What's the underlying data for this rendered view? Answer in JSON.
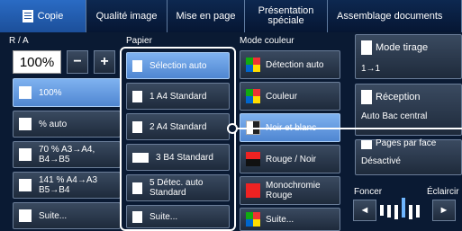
{
  "tabs": [
    {
      "label": "Copie",
      "active": true
    },
    {
      "label": "Qualité image"
    },
    {
      "label": "Mise en page"
    },
    {
      "label": "Présentation spéciale"
    },
    {
      "label": "Assemblage documents"
    }
  ],
  "ratio": {
    "header": "R / A",
    "value": "100%",
    "minus": "−",
    "plus": "+",
    "options": [
      "100%",
      "% auto",
      "70 % A3→A4, B4→B5",
      "141 % A4→A3 B5→B4",
      "Suite..."
    ]
  },
  "paper": {
    "header": "Papier",
    "options": [
      {
        "label": "Sélection auto"
      },
      {
        "label": "1 A4 Standard"
      },
      {
        "label": "2 A4 Standard"
      },
      {
        "label": "3 B4 Standard"
      },
      {
        "label": "5 Détec. auto Standard"
      },
      {
        "label": "Suite..."
      }
    ]
  },
  "color_mode": {
    "header": "Mode couleur",
    "options": [
      "Détection auto",
      "Couleur",
      "Noir et blanc",
      "Rouge / Noir",
      "Monochromie Rouge",
      "Suite..."
    ]
  },
  "right": {
    "copy_mode": {
      "title": "Mode tirage",
      "value": "1→1"
    },
    "output": {
      "title": "Réception",
      "value": "Auto Bac central"
    },
    "pages_per_side": {
      "title": "Pages par face",
      "value": "Désactivé"
    },
    "density": {
      "darker": "Foncer",
      "lighter": "Éclaircir",
      "left": "◄",
      "right": "►"
    }
  }
}
